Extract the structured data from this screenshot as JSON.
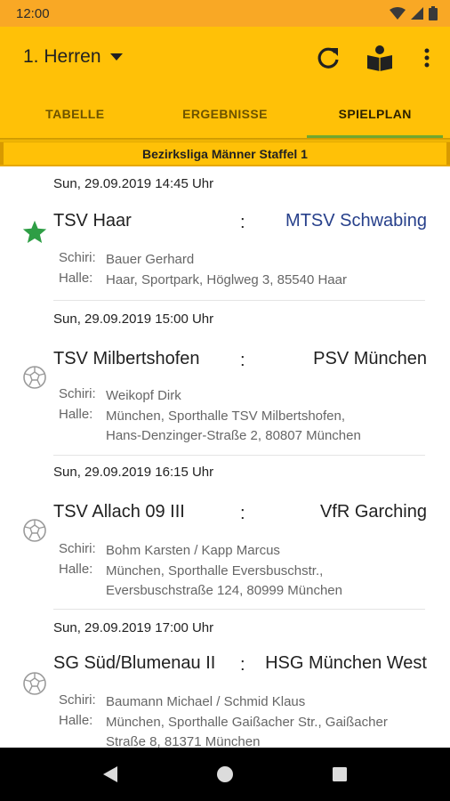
{
  "status_bar": {
    "time": "12:00",
    "icons": [
      "wifi-icon",
      "signal-icon",
      "battery-icon"
    ]
  },
  "app_bar": {
    "team_title": "1. Herren",
    "actions": [
      "refresh-icon",
      "reader-icon",
      "more-vert-icon"
    ]
  },
  "tabs": [
    {
      "label": "TABELLE",
      "active": false
    },
    {
      "label": "ERGEBNISSE",
      "active": false
    },
    {
      "label": "SPIELPLAN",
      "active": true
    }
  ],
  "league": "Bezirksliga Männer Staffel 1",
  "labels": {
    "referee": "Schiri:",
    "hall": "Halle:",
    "separator": ":"
  },
  "matches": [
    {
      "date": "Sun, 29.09.2019 14:45 Uhr",
      "home": "TSV Haar",
      "away": "MTSV Schwabing",
      "icon": "star-icon",
      "referee": "Bauer Gerhard",
      "hall_line1": "Haar, Sportpark, Höglweg 3, 85540 Haar",
      "hall_line2": ""
    },
    {
      "date": "Sun, 29.09.2019 15:00 Uhr",
      "home": "TSV Milbertshofen",
      "away": "PSV München",
      "icon": "ball-icon",
      "referee": "Weikopf Dirk",
      "hall_line1": "München, Sporthalle TSV Milbertshofen,",
      "hall_line2": "Hans-Denzinger-Straße 2, 80807 München"
    },
    {
      "date": "Sun, 29.09.2019 16:15 Uhr",
      "home": "TSV Allach 09 III",
      "away": "VfR Garching",
      "icon": "ball-icon",
      "referee": "Bohm Karsten / Kapp Marcus",
      "hall_line1": "München, Sporthalle Eversbuschstr.,",
      "hall_line2": "Eversbuschstraße 124, 80999 München"
    },
    {
      "date": "Sun, 29.09.2019 17:00 Uhr",
      "home": "SG Süd/Blumenau II",
      "away": "HSG München West",
      "icon": "ball-icon",
      "referee": "Baumann Michael / Schmid Klaus",
      "hall_line1": "München, Sporthalle Gaißacher Str., Gaißacher",
      "hall_line2": "Straße 8, 81371 München"
    }
  ],
  "colors": {
    "status_bar": "#F9A825",
    "app_bar": "#FFC107",
    "tab_indicator": "#6fa82f",
    "favorite_team": "#27408b",
    "star": "#2e9e45"
  },
  "nav": [
    "back-icon",
    "home-icon",
    "recents-icon"
  ]
}
